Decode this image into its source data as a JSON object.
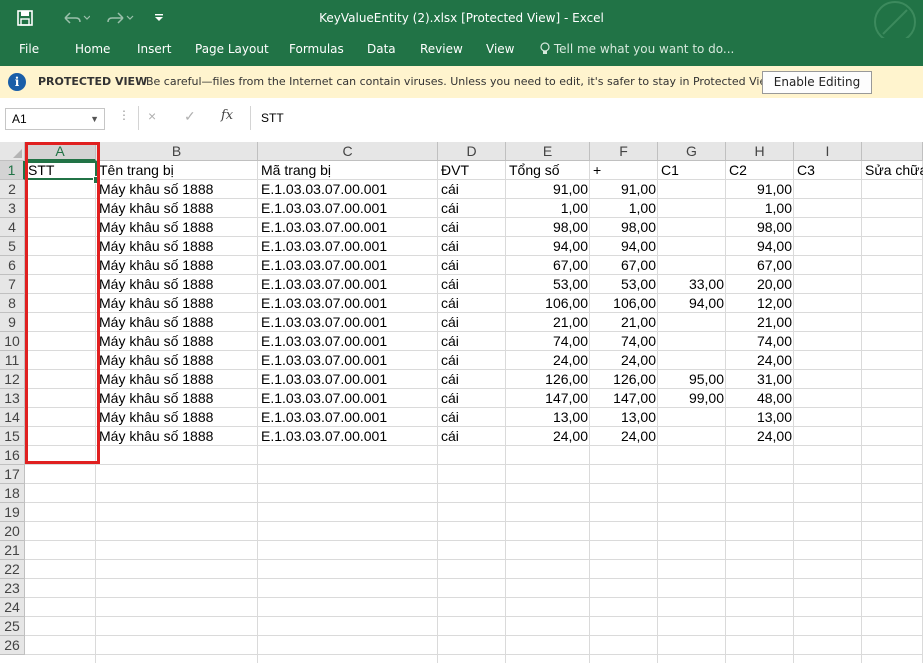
{
  "titlebar": {
    "title": "KeyValueEntity (2).xlsx  [Protected View] - Excel",
    "save_icon": "save-icon",
    "undo_icon": "undo-icon",
    "redo_icon": "redo-icon",
    "customize_icon": "customize-qat-icon"
  },
  "ribbon": {
    "tabs": [
      "File",
      "Home",
      "Insert",
      "Page Layout",
      "Formulas",
      "Data",
      "Review",
      "View"
    ],
    "tell_me": "Tell me what you want to do..."
  },
  "protected_view": {
    "title": "PROTECTED VIEW",
    "message": "Be careful—files from the Internet can contain viruses. Unless you need to edit, it's safer to stay in Protected View.",
    "button": "Enable Editing"
  },
  "formula_bar": {
    "name_box": "A1",
    "cancel_icon": "×",
    "enter_icon": "✓",
    "fx": "fx",
    "value": "STT"
  },
  "sheet": {
    "columns": [
      "A",
      "B",
      "C",
      "D",
      "E",
      "F",
      "G",
      "H",
      "I",
      ""
    ],
    "row_numbers": [
      "1",
      "2",
      "3",
      "4",
      "5",
      "6",
      "7",
      "8",
      "9",
      "10",
      "11",
      "12",
      "13",
      "14",
      "15",
      "16",
      "17",
      "18",
      "19",
      "20",
      "21",
      "22",
      "23",
      "24",
      "25",
      "26"
    ],
    "header_row": [
      "STT",
      "Tên trang bị",
      "Mã trang bị",
      "ĐVT",
      "Tổng số",
      "+",
      "C1",
      "C2",
      "C3",
      "Sửa chữa"
    ],
    "rows": [
      [
        "",
        "Máy khâu số 1888",
        "E.1.03.03.07.00.001",
        "cái",
        "91,00",
        "91,00",
        "",
        "91,00",
        ""
      ],
      [
        "",
        "Máy khâu số 1888",
        "E.1.03.03.07.00.001",
        "cái",
        "1,00",
        "1,00",
        "",
        "1,00",
        ""
      ],
      [
        "",
        "Máy khâu số 1888",
        "E.1.03.03.07.00.001",
        "cái",
        "98,00",
        "98,00",
        "",
        "98,00",
        ""
      ],
      [
        "",
        "Máy khâu số 1888",
        "E.1.03.03.07.00.001",
        "cái",
        "94,00",
        "94,00",
        "",
        "94,00",
        ""
      ],
      [
        "",
        "Máy khâu số 1888",
        "E.1.03.03.07.00.001",
        "cái",
        "67,00",
        "67,00",
        "",
        "67,00",
        ""
      ],
      [
        "",
        "Máy khâu số 1888",
        "E.1.03.03.07.00.001",
        "cái",
        "53,00",
        "53,00",
        "33,00",
        "20,00",
        ""
      ],
      [
        "",
        "Máy khâu số 1888",
        "E.1.03.03.07.00.001",
        "cái",
        "106,00",
        "106,00",
        "94,00",
        "12,00",
        ""
      ],
      [
        "",
        "Máy khâu số 1888",
        "E.1.03.03.07.00.001",
        "cái",
        "21,00",
        "21,00",
        "",
        "21,00",
        ""
      ],
      [
        "",
        "Máy khâu số 1888",
        "E.1.03.03.07.00.001",
        "cái",
        "74,00",
        "74,00",
        "",
        "74,00",
        ""
      ],
      [
        "",
        "Máy khâu số 1888",
        "E.1.03.03.07.00.001",
        "cái",
        "24,00",
        "24,00",
        "",
        "24,00",
        ""
      ],
      [
        "",
        "Máy khâu số 1888",
        "E.1.03.03.07.00.001",
        "cái",
        "126,00",
        "126,00",
        "95,00",
        "31,00",
        ""
      ],
      [
        "",
        "Máy khâu số 1888",
        "E.1.03.03.07.00.001",
        "cái",
        "147,00",
        "147,00",
        "99,00",
        "48,00",
        ""
      ],
      [
        "",
        "Máy khâu số 1888",
        "E.1.03.03.07.00.001",
        "cái",
        "13,00",
        "13,00",
        "",
        "13,00",
        ""
      ],
      [
        "",
        "Máy khâu số 1888",
        "E.1.03.03.07.00.001",
        "cái",
        "24,00",
        "24,00",
        "",
        "24,00",
        ""
      ]
    ]
  },
  "colors": {
    "excel_green": "#217346",
    "protected_bar": "#fff4ce",
    "highlight_red": "#e02020"
  }
}
